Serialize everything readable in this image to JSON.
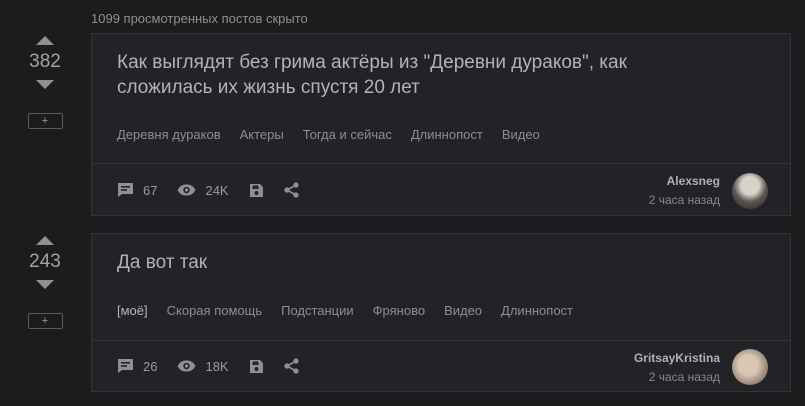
{
  "hidden_note": "1099 просмотренных постов скрыто",
  "posts": [
    {
      "rating": "382",
      "plus": "+",
      "title": "Как выглядят без грима актёры из \"Деревни дураков\", как сложилась их жизнь спустя 20 лет",
      "tags": [
        "Деревня дураков",
        "Актеры",
        "Тогда и сейчас",
        "Длиннопост",
        "Видео"
      ],
      "comments": "67",
      "views": "24K",
      "author": "Alexsneg",
      "time": "2 часа назад"
    },
    {
      "rating": "243",
      "plus": "+",
      "title": "Да вот так",
      "tags": [
        "[моё]",
        "Скорая помощь",
        "Подстанции",
        "Фряново",
        "Видео",
        "Длиннопост"
      ],
      "comments": "26",
      "views": "18K",
      "author": "GritsayKristina",
      "time": "2 часа назад"
    }
  ],
  "icons": {
    "vote_up": "arrow-up-icon",
    "vote_down": "arrow-down-icon",
    "comments": "comment-icon",
    "views": "eye-icon",
    "save": "save-icon",
    "share": "share-icon"
  },
  "colors": {
    "background": "#1b1c1e",
    "card": "#222326",
    "border": "#323337",
    "text": "#9a9b9d"
  }
}
